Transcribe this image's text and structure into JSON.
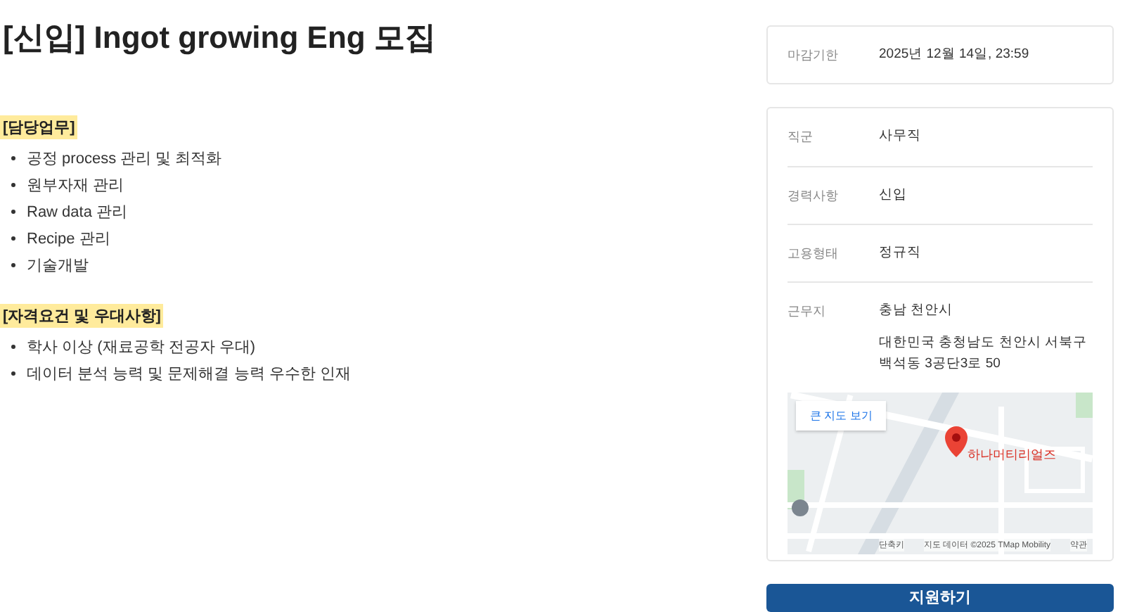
{
  "title": "[신입] Ingot growing Eng 모집",
  "sections": [
    {
      "heading": "[담당업무]",
      "items": [
        "공정 process 관리 및 최적화",
        "원부자재 관리",
        "Raw data 관리",
        "Recipe 관리",
        "기술개발"
      ]
    },
    {
      "heading": "[자격요건 및 우대사항]",
      "items": [
        "학사 이상 (재료공학 전공자 우대)",
        "데이터 분석 능력 및 문제해결 능력 우수한 인재"
      ]
    }
  ],
  "deadline": {
    "label": "마감기한",
    "value": "2025년 12월 14일, 23:59"
  },
  "details": [
    {
      "label": "직군",
      "values": [
        "사무직"
      ]
    },
    {
      "label": "경력사항",
      "values": [
        "신입"
      ]
    },
    {
      "label": "고용형태",
      "values": [
        "정규직"
      ]
    },
    {
      "label": "근무지",
      "values": [
        "충남 천안시",
        "대한민국 충청남도 천안시 서북구 백석동 3공단3로 50"
      ]
    }
  ],
  "map": {
    "button": "큰 지도 보기",
    "marker_label": "하나머티리얼즈",
    "footer": [
      "단축키",
      "지도 데이터 ©2025 TMap Mobility",
      "약관"
    ]
  },
  "apply_button": "지원하기"
}
